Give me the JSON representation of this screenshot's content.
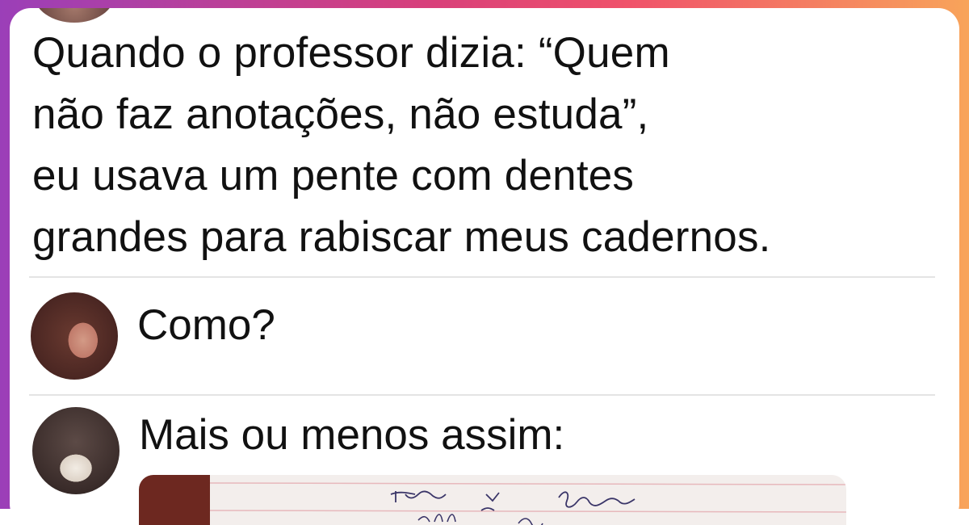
{
  "post": {
    "text_lines": [
      "Quando o professor dizia: “Quem",
      "não faz anotações, não estuda”,",
      "eu usava um pente com dentes",
      "grandes para rabiscar meus cadernos."
    ]
  },
  "comments": [
    {
      "text": "Como?"
    },
    {
      "text": "Mais ou menos assim:"
    }
  ],
  "colors": {
    "frame_gradient": [
      "#9b3fb8",
      "#d9407a",
      "#f0526a",
      "#f8a45a"
    ],
    "text": "#111111",
    "divider": "#e4e4e4"
  }
}
